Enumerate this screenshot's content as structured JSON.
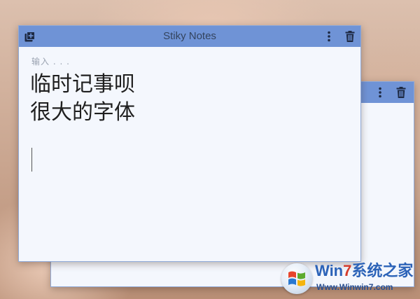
{
  "background_note": {
    "menu_icon": "more-vertical-icon",
    "delete_icon": "trash-icon"
  },
  "front_note": {
    "title": "Stiky Notes",
    "new_note_icon": "add-note-icon",
    "menu_icon": "more-vertical-icon",
    "delete_icon": "trash-icon",
    "placeholder": "输入 . . .",
    "content": "临时记事呗\n很大的字体"
  },
  "watermark": {
    "brand_win": "Win",
    "brand_seven": "7",
    "brand_cn": "系统之家",
    "url": "Www.Winwin7.com"
  },
  "colors": {
    "header": "#6f93d6",
    "note_bg": "#f4f7fd",
    "title_text": "#34445e",
    "icon": "#1e2a44"
  }
}
